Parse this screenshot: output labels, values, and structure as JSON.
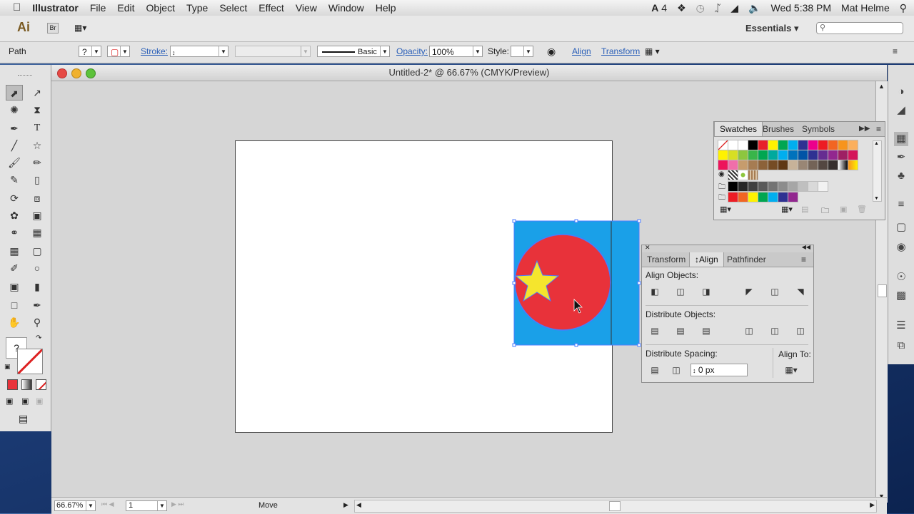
{
  "menubar": {
    "apple": "",
    "app": "Illustrator",
    "items": [
      "File",
      "Edit",
      "Object",
      "Type",
      "Select",
      "Effect",
      "View",
      "Window",
      "Help"
    ],
    "status": {
      "ai_count": "4",
      "clock": "Wed 5:38 PM",
      "user": "Mat Helme"
    }
  },
  "appbar": {
    "logo": "Ai",
    "bridge": "Br",
    "workspace": "Essentials",
    "search_placeholder": ""
  },
  "control": {
    "selection_type": "Path",
    "fill_label": "?",
    "stroke_label": "Stroke:",
    "stroke_weight": "",
    "brush_def": "Basic",
    "opacity_label": "Opacity:",
    "opacity_value": "100%",
    "style_label": "Style:",
    "align_link": "Align",
    "transform_link": "Transform"
  },
  "document": {
    "title": "Untitled-2* @ 66.67% (CMYK/Preview)"
  },
  "artwork": {
    "rect_color": "#1aa0e8",
    "circle_color": "#e8323a",
    "star_color": "#f5e52d",
    "selection_color": "#4a7bff"
  },
  "statusbar": {
    "zoom": "66.67%",
    "page": "1",
    "tool_status": "Move"
  },
  "swatches_panel": {
    "tabs": [
      "Swatches",
      "Brushes",
      "Symbols"
    ],
    "active_tab": "Swatches",
    "rows": [
      [
        "none",
        "registration",
        "#ffffff",
        "#000000",
        "#e8202a",
        "#fff200",
        "#00a651",
        "#00aeef",
        "#2e3192",
        "#ec008c",
        "#ed1c24",
        "#f26522",
        "#f7941d",
        "#fbaf5d"
      ],
      [
        "#fff200",
        "#d7df23",
        "#8dc63f",
        "#39b54a",
        "#00a651",
        "#00a99d",
        "#00aeef",
        "#0072bc",
        "#0054a6",
        "#2e3192",
        "#662d91",
        "#92278f",
        "#9e1f63",
        "#d4145a"
      ],
      [
        "#ed145b",
        "#f06eaa",
        "#c69c6d",
        "#a67c52",
        "#8c6239",
        "#754c24",
        "#603813",
        "#c7b299",
        "#998675",
        "#736357",
        "#534741",
        "#362f2d",
        "gradient1",
        "gradient2"
      ],
      [
        "pattern1",
        "pattern2",
        "pattern3"
      ],
      [
        "#000000",
        "#262626",
        "#404040",
        "#595959",
        "#737373",
        "#8c8c8c",
        "#a6a6a6",
        "#bfbfbf",
        "#d9d9d9",
        "#f2f2f2"
      ],
      [
        "#ed1c24",
        "#f26522",
        "#fff200",
        "#00a651",
        "#00aeef",
        "#2e3192",
        "#92278f"
      ]
    ]
  },
  "align_panel": {
    "tabs": [
      "Transform",
      "Align",
      "Pathfinder"
    ],
    "active_tab": "Align",
    "align_objects_label": "Align Objects:",
    "distribute_objects_label": "Distribute Objects:",
    "distribute_spacing_label": "Distribute Spacing:",
    "spacing_value": "0 px",
    "align_to_label": "Align To:"
  }
}
